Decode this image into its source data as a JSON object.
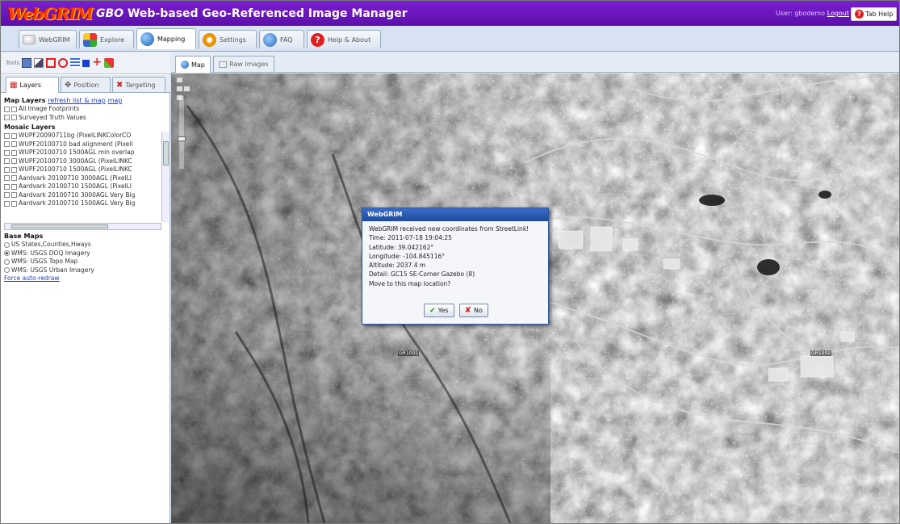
{
  "app": {
    "logo_text": "WebGRIM",
    "title": "GBO Web-based Geo-Referenced Image Manager",
    "title_prefix": "GBO",
    "title_rest": " Web-based Geo-Referenced Image Manager",
    "user_text": "User: gbodemo",
    "logout_label": "Logout",
    "tab_help_label": "Tab Help"
  },
  "main_tabs": [
    {
      "label": "WebGRIM"
    },
    {
      "label": "Explore"
    },
    {
      "label": "Mapping"
    },
    {
      "label": "Settings"
    },
    {
      "label": "FAQ"
    },
    {
      "label": "Help & About"
    }
  ],
  "tools": {
    "label": "Tools"
  },
  "panel_tabs": [
    {
      "label": "Layers"
    },
    {
      "label": "Position"
    },
    {
      "label": "Targeting"
    }
  ],
  "map_layers": {
    "title": "Map Layers",
    "refresh_label": "refresh list & map",
    "map_link": "map",
    "items": [
      {
        "label": "All Image Footprints"
      },
      {
        "label": "Surveyed Truth Values"
      }
    ]
  },
  "mosaic_layers": {
    "title": "Mosaic Layers",
    "items": [
      {
        "label": "WUPF20090711bg (PixelLINKColorCO"
      },
      {
        "label": "WUPF20100710 bad alignment (Pixell"
      },
      {
        "label": "WUPF20100710 1500AGL min overlap"
      },
      {
        "label": "WUPF20100710 3000AGL (PixelLINKC"
      },
      {
        "label": "WUPF20100710 1500AGL (PixelLINKC"
      },
      {
        "label": "Aardvark 20100710 3000AGL (PixelLI"
      },
      {
        "label": "Aardvark 20100710 1500AGL (PixelLI"
      },
      {
        "label": "Aardvark 20100710 3000AGL Very Big"
      },
      {
        "label": "Aardvark 20100710 1500AGL Very Big"
      }
    ]
  },
  "base_maps": {
    "title": "Base Maps",
    "selected_index": 1,
    "items": [
      {
        "label": "US States,Counties,Hways"
      },
      {
        "label": "WMS: USGS DOQ Imagery"
      },
      {
        "label": "WMS: USGS Topo Map"
      },
      {
        "label": "WMS: USGS Urban Imagery"
      }
    ],
    "force_redraw_label": "Force auto-redraw"
  },
  "map_tabs": [
    {
      "label": "Map"
    },
    {
      "label": "Raw Images"
    }
  ],
  "map_labels": [
    {
      "label": "GR1001"
    },
    {
      "label": "GR1002"
    }
  ],
  "dialog": {
    "title": "WebGRIM",
    "lines": [
      "WebGRIM received new coordinates from StreetLink!",
      "Time: 2011-07-18 19:04:25",
      "Latitude: 39.042162°",
      "Longitude: -104.845116°",
      "Altitude: 2037.4 m",
      "Detail: GC15 SE-Corner Gazebo (8)",
      "Move to this map location?"
    ],
    "yes_label": "Yes",
    "no_label": "No"
  },
  "colors": {
    "titlebar": "#6a16c0",
    "accent": "#2c56a3"
  }
}
